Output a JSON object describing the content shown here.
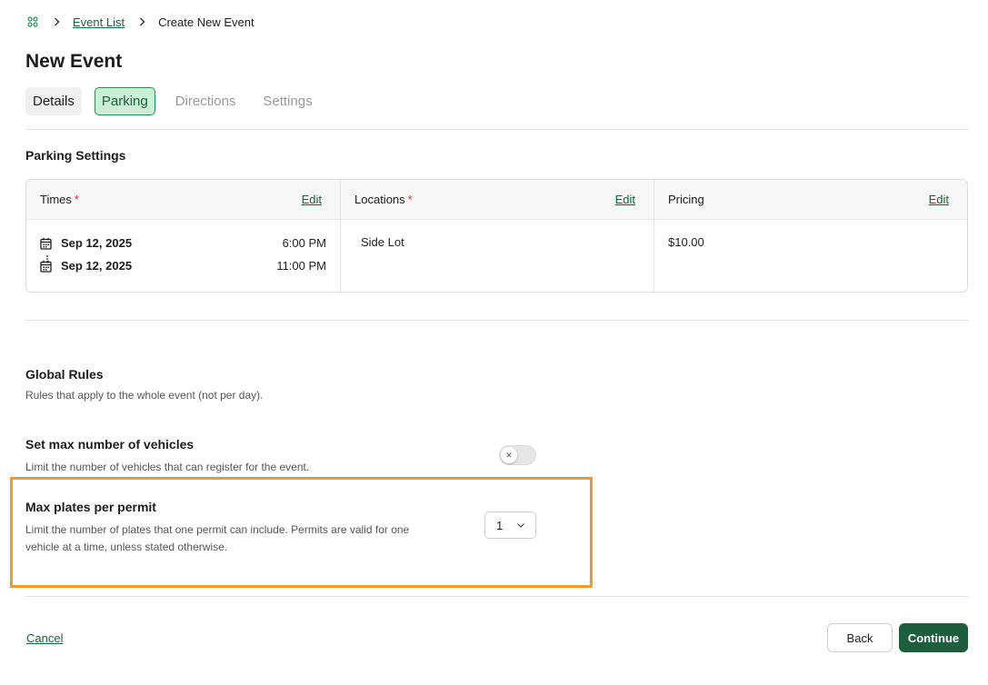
{
  "breadcrumb": {
    "home_icon": "grid-icon",
    "items": [
      "Event List",
      "Create New Event"
    ]
  },
  "page_title": "New Event",
  "tabs": [
    {
      "label": "Details",
      "state": "visited"
    },
    {
      "label": "Parking",
      "state": "active"
    },
    {
      "label": "Directions",
      "state": "disabled"
    },
    {
      "label": "Settings",
      "state": "disabled"
    }
  ],
  "parking_settings": {
    "title": "Parking Settings",
    "columns": {
      "times": {
        "label": "Times",
        "required_mark": "*",
        "edit_label": "Edit"
      },
      "locations": {
        "label": "Locations",
        "required_mark": "*",
        "edit_label": "Edit"
      },
      "pricing": {
        "label": "Pricing",
        "edit_label": "Edit"
      }
    },
    "times": {
      "start": {
        "date": "Sep 12, 2025",
        "time": "6:00 PM"
      },
      "end": {
        "date": "Sep 12, 2025",
        "time": "11:00 PM"
      }
    },
    "location": "Side Lot",
    "price": "$10.00"
  },
  "global_rules": {
    "title": "Global Rules",
    "subtitle": "Rules that apply to the whole event (not per day).",
    "max_vehicles": {
      "title": "Set max number of vehicles",
      "description": "Limit the number of vehicles that can register for the event.",
      "enabled": false
    },
    "max_plates": {
      "title": "Max plates per permit",
      "description_line1": "Limit the number of plates that one permit can include. Permits are valid for one",
      "description_line2": "vehicle at a time, unless stated otherwise.",
      "value": "1"
    }
  },
  "footer": {
    "cancel_label": "Cancel",
    "back_label": "Back",
    "continue_label": "Continue"
  },
  "colors": {
    "brand": "#1f5e3d",
    "tab_active_bg": "#c9efd6",
    "required": "#d13a3a",
    "highlight": "#f29a2e"
  }
}
